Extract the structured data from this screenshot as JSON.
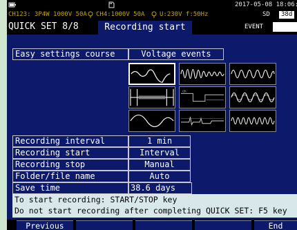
{
  "status_bar": {
    "date_time": "2017-05-08 18:06:",
    "channel_config": "CH123: 3P4W  1000V  50A",
    "ch4_config": "CH4:1000V  50A",
    "voltage_freq": "U:230V f:50Hz",
    "storage_label": "SD",
    "storage_value": "38d"
  },
  "header": {
    "step": "QUICK SET 8/8",
    "title": "Recording start",
    "event_label": "EVENT"
  },
  "easy_settings": {
    "label": "Easy settings course",
    "value": "Voltage events"
  },
  "recording": {
    "rows": [
      {
        "label": "Recording interval",
        "value": "1 min"
      },
      {
        "label": "Recording start",
        "value": "Interval"
      },
      {
        "label": "Recording stop",
        "value": "Manual"
      },
      {
        "label": "Folder/file name",
        "value": "Auto"
      },
      {
        "label": "Save time",
        "value": "38.6 days"
      }
    ]
  },
  "message": {
    "line1": "To start recording: START/STOP key",
    "line2": "Do not start recording after completing QUICK SET: F5 key"
  },
  "function_keys": {
    "f1": "Previous",
    "f5": "End"
  },
  "colors": {
    "screen_bg": "#0d1a6b",
    "status_text": "#c9a400",
    "message_bg": "#d8e8ea"
  }
}
